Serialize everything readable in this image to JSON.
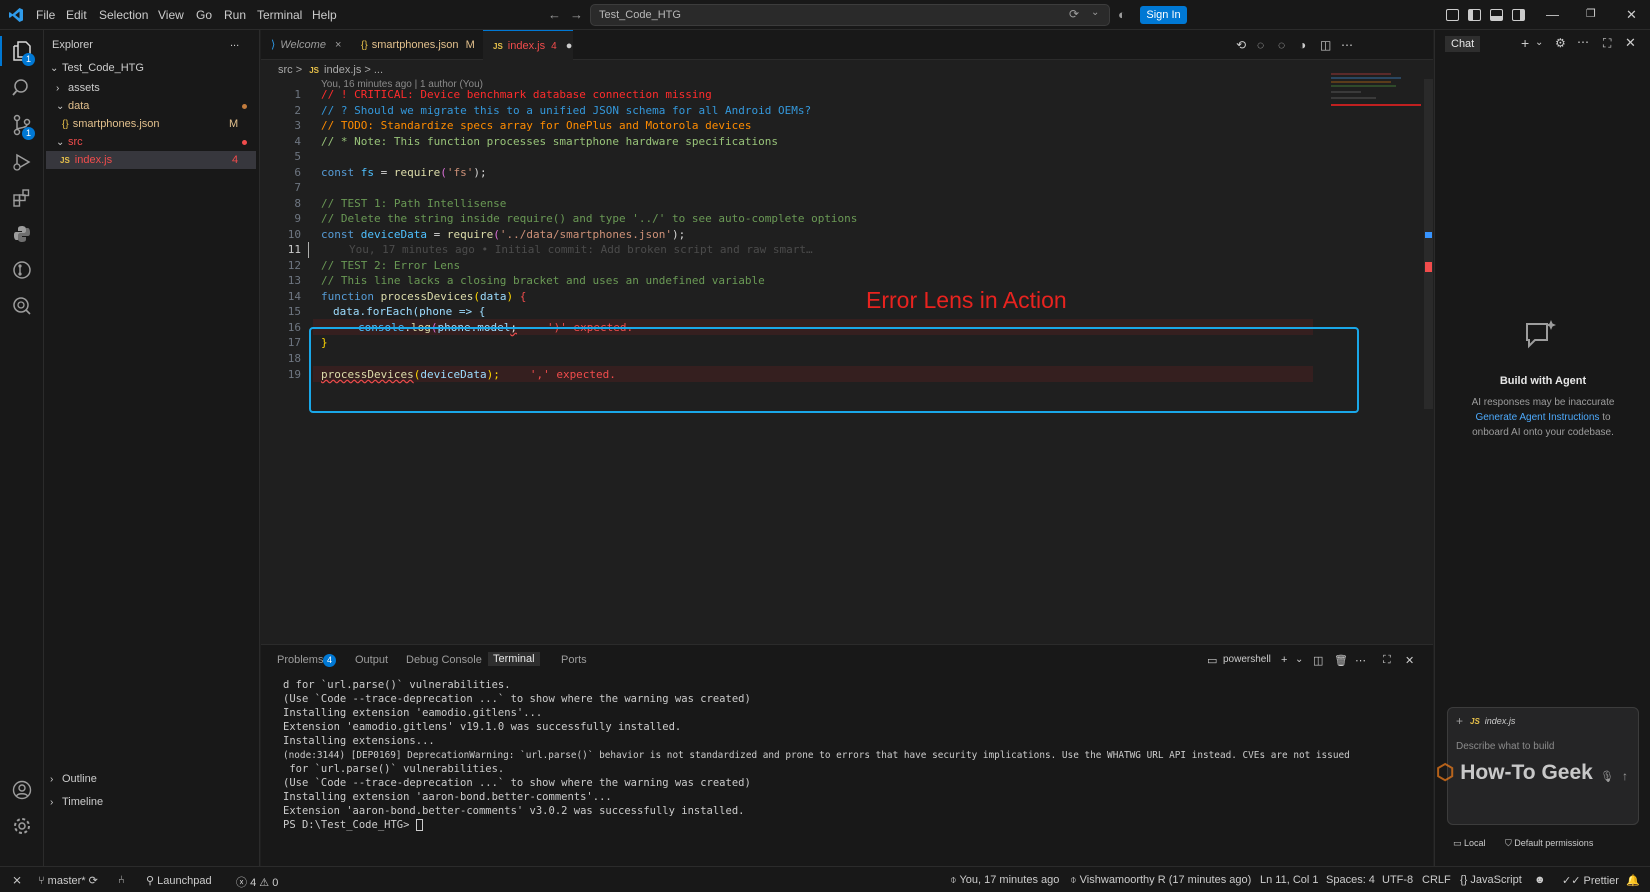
{
  "titlebar": {
    "menu": [
      "File",
      "Edit",
      "Selection",
      "View",
      "Go",
      "Run",
      "Terminal",
      "Help"
    ],
    "search_text": "Test_Code_HTG",
    "signin_label": "Sign In"
  },
  "activity": {
    "explorer_badge": "1",
    "scm_badge": "1"
  },
  "sidebar": {
    "title": "Explorer",
    "more": "...",
    "root": "Test_Code_HTG",
    "items": [
      {
        "label": "assets",
        "chevron": "›"
      },
      {
        "label": "data",
        "chevron": "⌄"
      },
      {
        "label": "smartphones.json",
        "decoration": "M",
        "icon": "{}"
      },
      {
        "label": "src",
        "chevron": "⌄"
      },
      {
        "label": "index.js",
        "decoration": "4",
        "icon": "JS"
      }
    ],
    "outline": "Outline",
    "timeline": "Timeline"
  },
  "tabs": [
    {
      "label": "Welcome",
      "close": "×"
    },
    {
      "label": "smartphones.json",
      "modifier": "M"
    },
    {
      "label": "index.js",
      "modifier": "4"
    }
  ],
  "breadcrumb": {
    "folder": "src",
    "sep": ">",
    "file": "index.js",
    "tail": "> ..."
  },
  "blame_header": "You, 16 minutes ago | 1 author (You)",
  "code": [
    {
      "n": "1",
      "text": "// ! CRITICAL: Device benchmark database connection missing"
    },
    {
      "n": "2",
      "text": "// ? Should we migrate this to a unified JSON schema for all Android OEMs?"
    },
    {
      "n": "3",
      "text": "// TODO: Standardize specs array for OnePlus and Motorola devices"
    },
    {
      "n": "4",
      "text": "// * Note: This function processes smartphone hardware specifications"
    },
    {
      "n": "5",
      "text": ""
    },
    {
      "n": "6",
      "kw": "const",
      "ident": "fs",
      "eq": "=",
      "fn": "require",
      "open": "(",
      "str": "'fs'",
      "close": ");"
    },
    {
      "n": "7",
      "text": ""
    },
    {
      "n": "8",
      "text": "// TEST 1: Path Intellisense"
    },
    {
      "n": "9",
      "text": "// Delete the string inside require() and type '../' to see auto-complete options"
    },
    {
      "n": "10",
      "kw": "const",
      "ident": "deviceData",
      "eq": "=",
      "fn": "require",
      "open": "(",
      "str": "'../data/smartphones.json'",
      "close": ");"
    },
    {
      "n": "11",
      "text": "You, 17 minutes ago • Initial commit: Add broken script and raw smart…"
    },
    {
      "n": "12",
      "text": "// TEST 2: Error Lens"
    },
    {
      "n": "13",
      "text": "// This line lacks a closing bracket and uses an undefined variable"
    },
    {
      "n": "14",
      "kw": "function",
      "fn": "processDevices",
      "open": "(",
      "param": "data",
      "close": ")",
      "brace": "{"
    },
    {
      "n": "15",
      "text": "data.forEach(phone => {"
    },
    {
      "n": "16",
      "obj": "console",
      "dot": ".",
      "fn": "log",
      "open": "(",
      "arg": "phone.model",
      "semi": ";",
      "error": "')' expected."
    },
    {
      "n": "17",
      "text": "}"
    },
    {
      "n": "18",
      "text": ""
    },
    {
      "n": "19",
      "fn": "processDevices",
      "open": "(",
      "arg": "deviceData",
      "close": ");",
      "error": "',' expected."
    }
  ],
  "annotation": {
    "label": "Error Lens in Action",
    "color": "#e8231f",
    "box_color": "#1aa7e8"
  },
  "panel": {
    "tabs": [
      "Problems",
      "Output",
      "Debug Console",
      "Terminal",
      "Ports"
    ],
    "problems_badge": "4",
    "shell": "powershell",
    "lines": [
      "d for `url.parse()` vulnerabilities.",
      "(Use `Code --trace-deprecation ...` to show where the warning was created)",
      "Installing extension 'eamodio.gitlens'...",
      "Extension 'eamodio.gitlens' v19.1.0 was successfully installed.",
      "Installing extensions...",
      "(node:3144) [DEP0169] DeprecationWarning: `url.parse()` behavior is not standardized and prone to errors that have security implications. Use the WHATWG URL API instead. CVEs are not issued",
      " for `url.parse()` vulnerabilities.",
      "(Use `Code --trace-deprecation ...` to show where the warning was created)",
      "Installing extension 'aaron-bond.better-comments'...",
      "Extension 'aaron-bond.better-comments' v3.0.2 was successfully installed.",
      "PS D:\\Test_Code_HTG> "
    ]
  },
  "chat": {
    "title": "Chat",
    "heading": "Build with Agent",
    "desc_1": "AI responses may be inaccurate",
    "link": "Generate Agent Instructions",
    "desc_2": " to",
    "desc_3": "onboard AI onto your codebase.",
    "context_file": "index.js",
    "input_placeholder": "Describe what to build",
    "watermark": "How-To Geek",
    "local": "Local",
    "permissions": "Default permissions"
  },
  "status": {
    "branch": "master*",
    "launchpad": "Launchpad",
    "errors": "4",
    "warnings": "0",
    "blame": "You, 17 minutes ago",
    "author": "Vishwamoorthy R (17 minutes ago)",
    "position": "Ln 11, Col 1",
    "spaces": "Spaces: 4",
    "encoding": "UTF-8",
    "eol": "CRLF",
    "language": "JavaScript",
    "prettier": "Prettier"
  }
}
